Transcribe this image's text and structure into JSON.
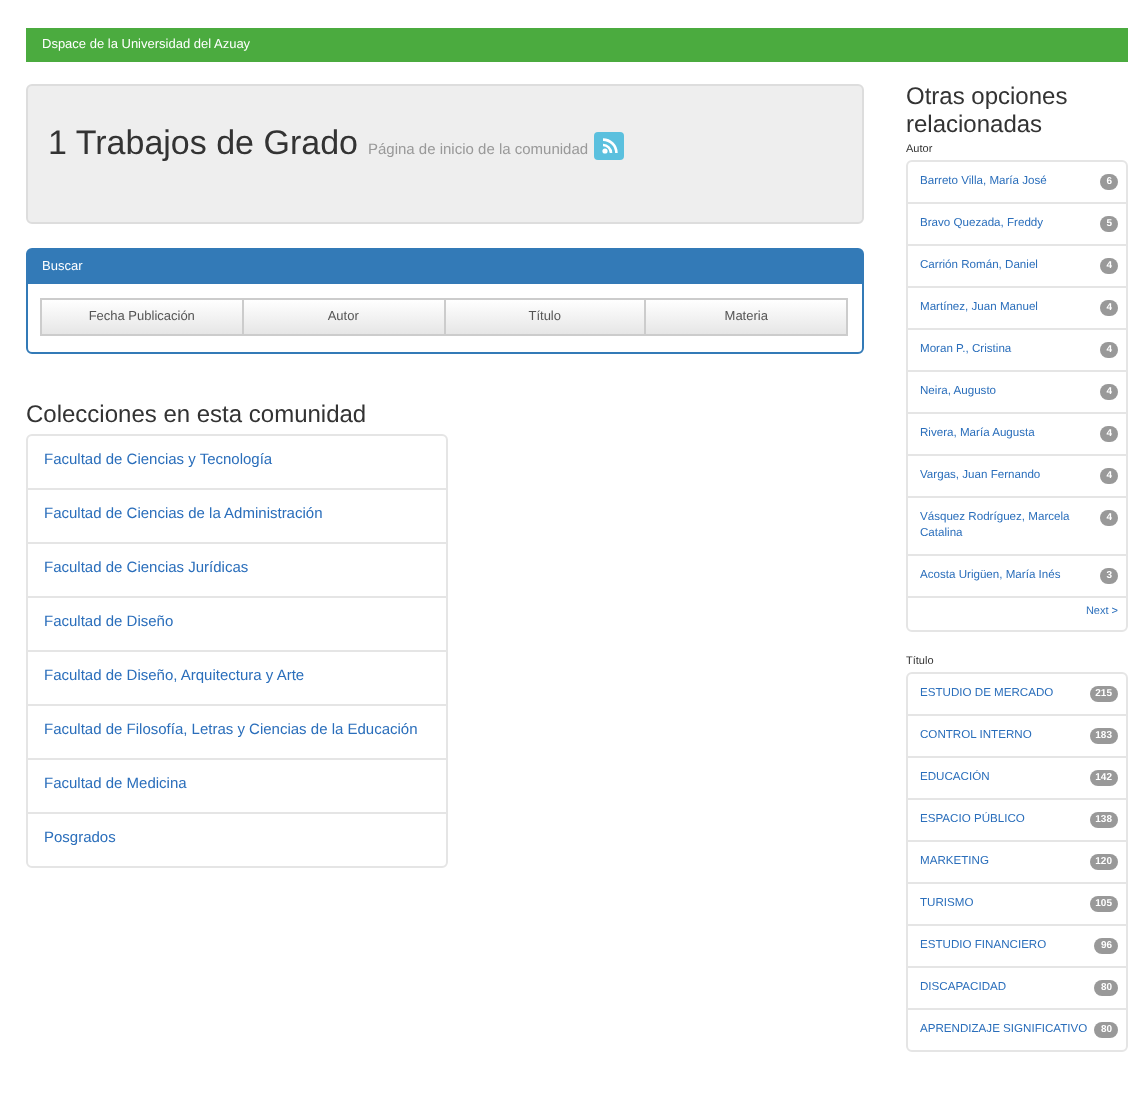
{
  "breadcrumb": "Dspace de la Universidad del Azuay",
  "header": {
    "title": "1 Trabajos de Grado",
    "subtitle": "Página de inicio de la comunidad"
  },
  "search_panel": {
    "title": "Buscar",
    "buttons": [
      "Fecha Publicación",
      "Autor",
      "Título",
      "Materia"
    ]
  },
  "collections": {
    "title": "Colecciones en esta comunidad",
    "items": [
      "Facultad de Ciencias y Tecnología",
      "Facultad de Ciencias de la Administración",
      "Facultad de Ciencias Jurídicas",
      "Facultad de Diseño",
      "Facultad de Diseño, Arquitectura y Arte",
      "Facultad de Filosofía, Letras y Ciencias de la Educación",
      "Facultad de Medicina",
      "Posgrados"
    ]
  },
  "sidebar": {
    "title": "Otras opciones relacionadas",
    "author_label": "Autor",
    "authors": [
      {
        "name": "Barreto Villa, María José",
        "count": "6"
      },
      {
        "name": "Bravo Quezada, Freddy",
        "count": "5"
      },
      {
        "name": "Carrión Román, Daniel",
        "count": "4"
      },
      {
        "name": "Martínez, Juan Manuel",
        "count": "4"
      },
      {
        "name": "Moran P., Cristina",
        "count": "4"
      },
      {
        "name": "Neira, Augusto",
        "count": "4"
      },
      {
        "name": "Rivera, María Augusta",
        "count": "4"
      },
      {
        "name": "Vargas, Juan Fernando",
        "count": "4"
      },
      {
        "name": "Vásquez Rodríguez, Marcela Catalina",
        "count": "4"
      },
      {
        "name": "Acosta Urigüen, María Inés",
        "count": "3"
      }
    ],
    "next": "Next >",
    "title_label": "Título",
    "titles": [
      {
        "name": "ESTUDIO DE MERCADO",
        "count": "215"
      },
      {
        "name": "CONTROL INTERNO",
        "count": "183"
      },
      {
        "name": "EDUCACIÓN",
        "count": "142"
      },
      {
        "name": "ESPACIO PÚBLICO",
        "count": "138"
      },
      {
        "name": "MARKETING",
        "count": "120"
      },
      {
        "name": "TURISMO",
        "count": "105"
      },
      {
        "name": "ESTUDIO FINANCIERO",
        "count": "96"
      },
      {
        "name": "DISCAPACIDAD",
        "count": "80"
      },
      {
        "name": "APRENDIZAJE SIGNIFICATIVO",
        "count": "80"
      }
    ]
  }
}
